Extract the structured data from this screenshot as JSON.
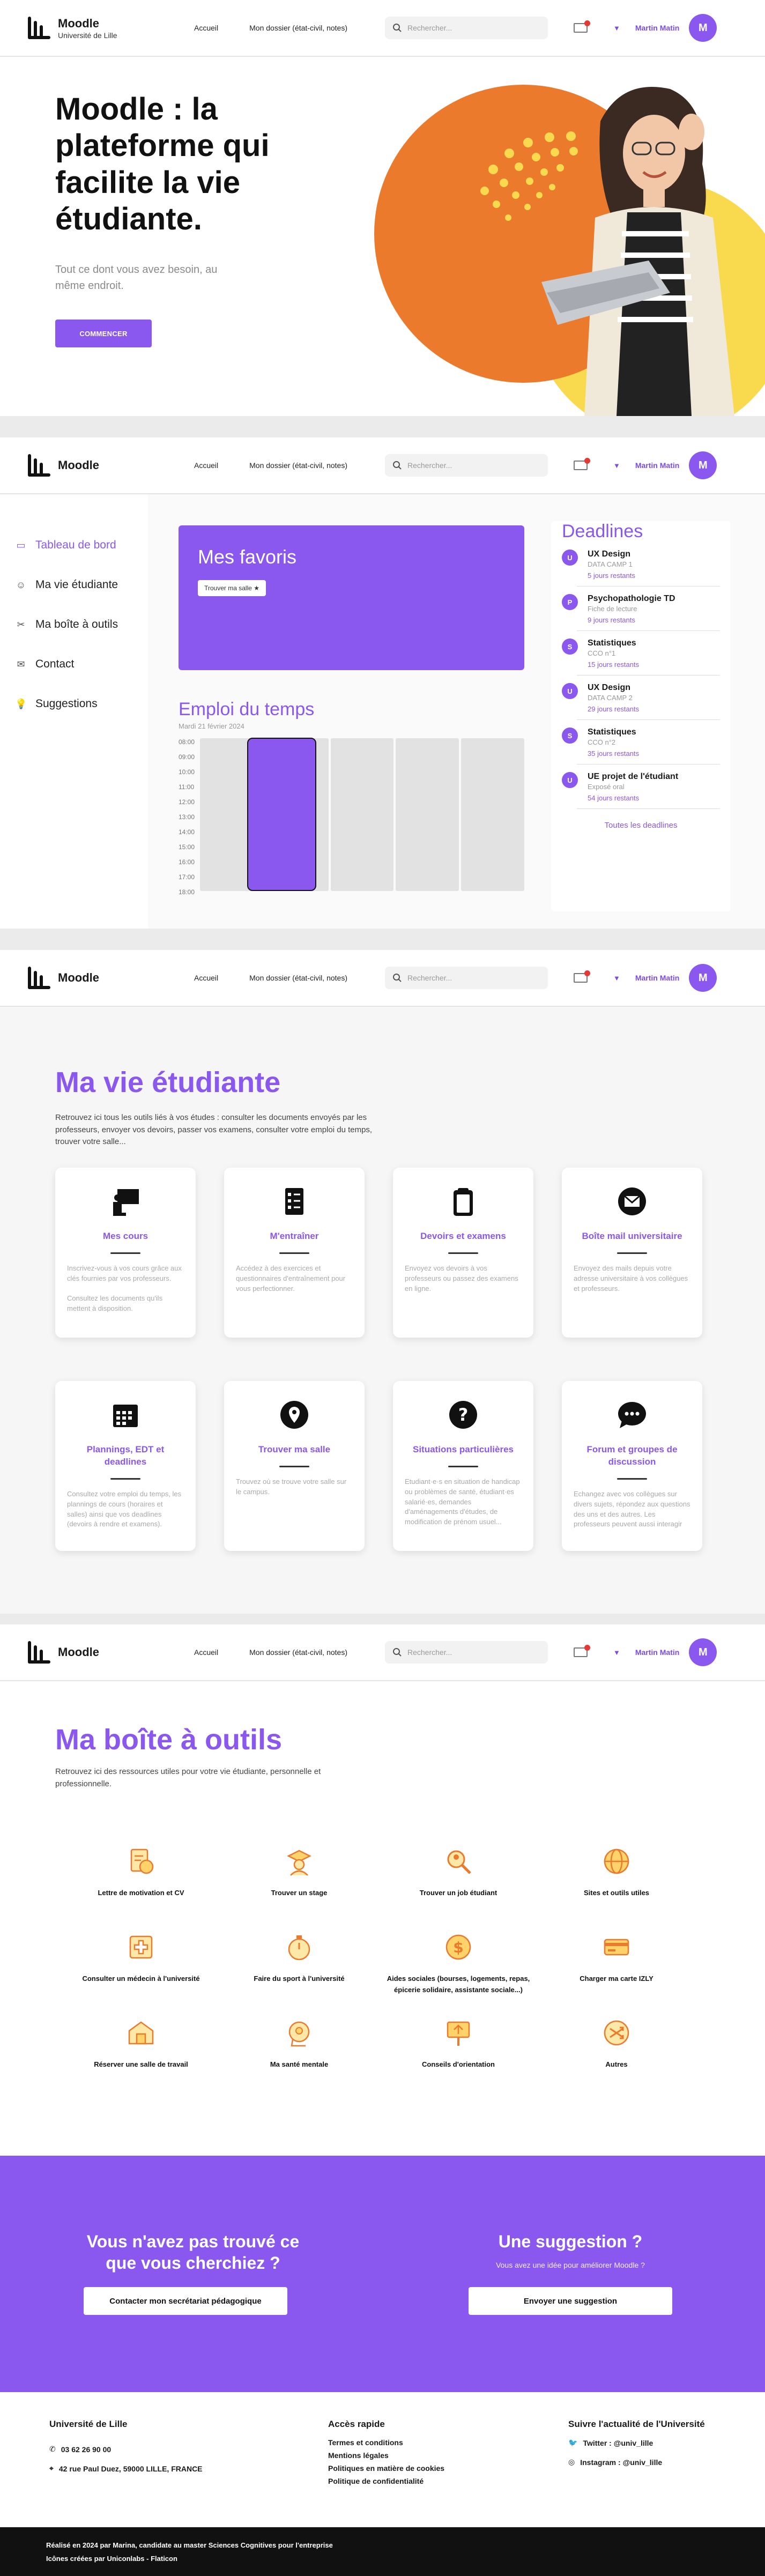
{
  "header": {
    "app_name": "Moodle",
    "university": "Université de Lille",
    "nav": [
      "Accueil",
      "Mon dossier (état-civil, notes)"
    ],
    "search_placeholder": "Rechercher...",
    "user_name": "Martin Matin",
    "avatar_initial": "M"
  },
  "hero": {
    "title": "Moodle : la plateforme qui facilite la vie étudiante.",
    "subtitle": "Tout ce dont vous avez besoin, au même endroit.",
    "cta": "COMMENCER"
  },
  "dashboard": {
    "sidebar": [
      {
        "label": "Tableau de bord",
        "icon": "monitor-icon",
        "active": true
      },
      {
        "label": "Ma vie étudiante",
        "icon": "user-group-icon",
        "active": false
      },
      {
        "label": "Ma boîte à outils",
        "icon": "tools-icon",
        "active": false
      },
      {
        "label": "Contact",
        "icon": "envelope-icon",
        "active": false
      },
      {
        "label": "Suggestions",
        "icon": "lightbulb-icon",
        "active": false
      }
    ],
    "favoris_title": "Mes favoris",
    "favoris_pill": "Trouver ma salle",
    "edt_title": "Emploi du temps",
    "edt_date": "Mardi 21 février 2024",
    "hours": [
      "08:00",
      "09:00",
      "10:00",
      "11:00",
      "12:00",
      "13:00",
      "14:00",
      "15:00",
      "16:00",
      "17:00",
      "18:00"
    ],
    "deadlines_title": "Deadlines",
    "deadlines": [
      {
        "badge": "U",
        "title": "UX Design",
        "sub": "DATA CAMP 1",
        "left": "5 jours restants"
      },
      {
        "badge": "P",
        "title": "Psychopathologie TD",
        "sub": "Fiche de lecture",
        "left": "9 jours restants"
      },
      {
        "badge": "S",
        "title": "Statistiques",
        "sub": "CCO n°1",
        "left": "15 jours restants"
      },
      {
        "badge": "U",
        "title": "UX Design",
        "sub": "DATA CAMP 2",
        "left": "29 jours restants"
      },
      {
        "badge": "S",
        "title": "Statistiques",
        "sub": "CCO n°2",
        "left": "35 jours restants"
      },
      {
        "badge": "U",
        "title": "UE projet de l'étudiant",
        "sub": "Exposé oral",
        "left": "54 jours restants"
      }
    ],
    "all_deadlines": "Toutes les deadlines"
  },
  "vie": {
    "title": "Ma vie étudiante",
    "desc": "Retrouvez ici tous les outils liés à vos études : consulter les documents envoyés par les professeurs, envoyer vos devoirs, passer vos examens, consulter votre emploi du temps, trouver votre salle...",
    "cards": [
      {
        "icon": "teacher-board-icon",
        "title": "Mes cours",
        "desc": "Inscrivez-vous à vos cours grâce aux clés fournies par vos professeurs.\n\nConsultez les documents qu'ils mettent à disposition."
      },
      {
        "icon": "checklist-icon",
        "title": "M'entraîner",
        "desc": "Accédez à des exercices et questionnaires d'entraînement pour vous perfectionner."
      },
      {
        "icon": "clipboard-icon",
        "title": "Devoirs et examens",
        "desc": "Envoyez vos devoirs à vos professeurs ou passez des examens en ligne."
      },
      {
        "icon": "mail-circle-icon",
        "title": "Boîte mail universitaire",
        "desc": "Envoyez des mails depuis votre adresse universitaire à vos collègues et professeurs."
      },
      {
        "icon": "calendar-icon",
        "title": "Plannings, EDT et deadlines",
        "desc": "Consultez votre emploi du temps, les plannings de cours (horaires et salles) ainsi que vos deadlines (devoirs à rendre et examens)."
      },
      {
        "icon": "location-pin-icon",
        "title": "Trouver ma salle",
        "desc": "Trouvez où se trouve votre salle sur le campus."
      },
      {
        "icon": "question-circle-icon",
        "title": "Situations particulières",
        "desc": "Etudiant·e·s en situation de handicap ou problèmes de santé, étudiant·es salarié·es, demandes d'aménagements d'études, de modification de prénom usuel..."
      },
      {
        "icon": "chat-bubble-icon",
        "title": "Forum et groupes de discussion",
        "desc": "Echangez avec vos collègues sur divers sujets, répondez aux questions des uns et des autres. Les professeurs peuvent aussi interagir"
      }
    ]
  },
  "box": {
    "title": "Ma boîte à outils",
    "desc": "Retrouvez ici des ressources utiles pour votre vie étudiante, personnelle et professionnelle.",
    "tools": [
      {
        "icon": "cv-icon",
        "label": "Lettre de motivation et CV"
      },
      {
        "icon": "graduate-icon",
        "label": "Trouver un stage"
      },
      {
        "icon": "job-search-icon",
        "label": "Trouver un job étudiant"
      },
      {
        "icon": "globe-icon",
        "label": "Sites et outils utiles"
      },
      {
        "icon": "medical-icon",
        "label": "Consulter un médecin à l'université"
      },
      {
        "icon": "stopwatch-icon",
        "label": "Faire du sport à l'université"
      },
      {
        "icon": "money-icon",
        "label": "Aides sociales (bourses, logements, repas, épicerie solidaire, assistante sociale...)"
      },
      {
        "icon": "card-icon",
        "label": "Charger ma carte IZLY"
      },
      {
        "icon": "room-icon",
        "label": "Réserver une salle de travail"
      },
      {
        "icon": "mental-health-icon",
        "label": "Ma santé mentale"
      },
      {
        "icon": "signpost-icon",
        "label": "Conseils d'orientation"
      },
      {
        "icon": "shuffle-icon",
        "label": "Autres"
      }
    ]
  },
  "band": {
    "left_title": "Vous n'avez pas trouvé ce que vous cherchiez ?",
    "left_button": "Contacter mon secrétariat pédagogique",
    "right_title": "Une suggestion ?",
    "right_small": "Vous avez une idée pour améliorer Moodle ?",
    "right_button": "Envoyer une suggestion"
  },
  "footer": {
    "col1_title": "Université de Lille",
    "phone": "03 62 26 90 00",
    "address": "42 rue Paul Duez, 59000 LILLE, FRANCE",
    "col2_title": "Accès rapide",
    "links": [
      "Termes et conditions",
      "Mentions légales",
      "Politiques en matière de cookies",
      "Politique de confidentialité"
    ],
    "col3_title": "Suivre l'actualité de l'Université",
    "twitter": "Twitter : @univ_lille",
    "instagram": "Instagram : @univ_lille",
    "credit1": "Réalisé en 2024 par Marina, candidate au master Sciences Cognitives pour l'entreprise",
    "credit2": "Icônes créées par Uniconlabs - Flaticon"
  },
  "colors": {
    "accent": "#8a57ef",
    "orange": "#ec7a2c",
    "yellow": "#f9d94e"
  }
}
